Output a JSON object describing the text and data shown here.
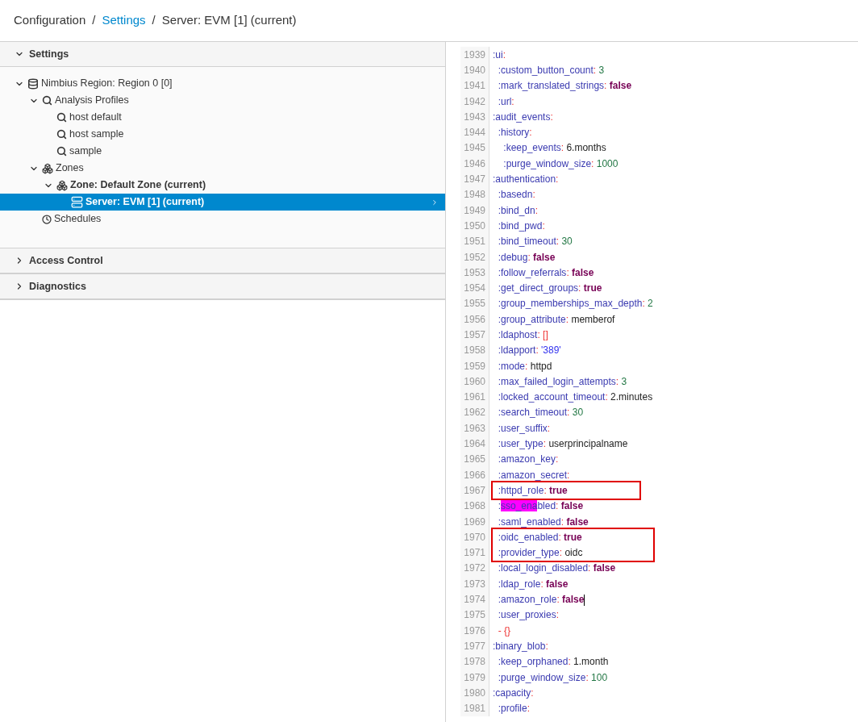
{
  "breadcrumb": [
    {
      "label": "Configuration",
      "link": false
    },
    {
      "separator": "/",
      "label": "Settings",
      "link": true
    },
    {
      "separator": "/",
      "label": "Server: EVM [1] (current)",
      "link": false
    }
  ],
  "sidebar": {
    "sections": [
      {
        "title": "Settings",
        "expanded": true,
        "tree": [
          {
            "label": "Nimbius Region: Region 0 [0]",
            "kind": "database",
            "bold": false,
            "selected": false,
            "expanded": true,
            "children": [
              {
                "label": "Analysis Profiles",
                "kind": "search",
                "bold": false,
                "selected": false,
                "expanded": true,
                "children": [
                  {
                    "label": "host default",
                    "kind": "search",
                    "bold": false,
                    "selected": false
                  },
                  {
                    "label": "host sample",
                    "kind": "search",
                    "bold": false,
                    "selected": false
                  },
                  {
                    "label": "sample",
                    "kind": "search",
                    "bold": false,
                    "selected": false
                  }
                ]
              },
              {
                "label": "Zones",
                "kind": "zone",
                "bold": false,
                "selected": false,
                "expanded": true,
                "children": [
                  {
                    "label": "Zone: Default Zone (current)",
                    "kind": "zone",
                    "bold": true,
                    "selected": false,
                    "expanded": true,
                    "children": [
                      {
                        "label": "Server: EVM [1] (current)",
                        "kind": "server",
                        "bold": true,
                        "selected": true
                      }
                    ]
                  }
                ]
              },
              {
                "label": "Schedules",
                "kind": "clock",
                "bold": false,
                "selected": false
              }
            ]
          }
        ]
      },
      {
        "title": "Access Control",
        "expanded": false
      },
      {
        "title": "Diagnostics",
        "expanded": false
      }
    ]
  },
  "editor": {
    "lines": [
      {
        "number": "1939",
        "tokens": [
          {
            "t": ":ui",
            "kind": "key"
          },
          {
            "t": ":",
            "kind": "punct"
          }
        ]
      },
      {
        "number": "1940",
        "tokens": [
          {
            "t": "  :custom_button_count",
            "kind": "key"
          },
          {
            "t": ":",
            "kind": "punct"
          },
          {
            "t": " 3",
            "kind": "number"
          }
        ]
      },
      {
        "number": "1941",
        "tokens": [
          {
            "t": "  :mark_translated_strings",
            "kind": "key"
          },
          {
            "t": ":",
            "kind": "punct"
          },
          {
            "t": " false",
            "kind": "bool"
          }
        ]
      },
      {
        "number": "1942",
        "tokens": [
          {
            "t": "  :url",
            "kind": "key"
          },
          {
            "t": ":",
            "kind": "punct"
          }
        ]
      },
      {
        "number": "1943",
        "tokens": [
          {
            "t": ":audit_events",
            "kind": "key"
          },
          {
            "t": ":",
            "kind": "punct"
          }
        ]
      },
      {
        "number": "1944",
        "tokens": [
          {
            "t": "  :history",
            "kind": "key"
          },
          {
            "t": ":",
            "kind": "punct"
          }
        ]
      },
      {
        "number": "1945",
        "tokens": [
          {
            "t": "    :keep_events",
            "kind": "key"
          },
          {
            "t": ":",
            "kind": "punct"
          },
          {
            "t": " 6.months",
            "kind": "plain"
          }
        ]
      },
      {
        "number": "1946",
        "tokens": [
          {
            "t": "    :purge_window_size",
            "kind": "key"
          },
          {
            "t": ":",
            "kind": "punct"
          },
          {
            "t": " 1000",
            "kind": "number"
          }
        ]
      },
      {
        "number": "1947",
        "tokens": [
          {
            "t": ":authentication",
            "kind": "key"
          },
          {
            "t": ":",
            "kind": "punct"
          }
        ]
      },
      {
        "number": "1948",
        "tokens": [
          {
            "t": "  :basedn",
            "kind": "key"
          },
          {
            "t": ":",
            "kind": "punct"
          }
        ]
      },
      {
        "number": "1949",
        "tokens": [
          {
            "t": "  :bind_dn",
            "kind": "key"
          },
          {
            "t": ":",
            "kind": "punct"
          }
        ]
      },
      {
        "number": "1950",
        "tokens": [
          {
            "t": "  :bind_pwd",
            "kind": "key"
          },
          {
            "t": ":",
            "kind": "punct"
          }
        ]
      },
      {
        "number": "1951",
        "tokens": [
          {
            "t": "  :bind_timeout",
            "kind": "key"
          },
          {
            "t": ":",
            "kind": "punct"
          },
          {
            "t": " 30",
            "kind": "number"
          }
        ]
      },
      {
        "number": "1952",
        "tokens": [
          {
            "t": "  :debug",
            "kind": "key"
          },
          {
            "t": ":",
            "kind": "punct"
          },
          {
            "t": " false",
            "kind": "bool"
          }
        ]
      },
      {
        "number": "1953",
        "tokens": [
          {
            "t": "  :follow_referrals",
            "kind": "key"
          },
          {
            "t": ":",
            "kind": "punct"
          },
          {
            "t": " false",
            "kind": "bool"
          }
        ]
      },
      {
        "number": "1954",
        "tokens": [
          {
            "t": "  :get_direct_groups",
            "kind": "key"
          },
          {
            "t": ":",
            "kind": "punct"
          },
          {
            "t": " true",
            "kind": "bool"
          }
        ]
      },
      {
        "number": "1955",
        "tokens": [
          {
            "t": "  :group_memberships_max_depth",
            "kind": "key"
          },
          {
            "t": ":",
            "kind": "punct"
          },
          {
            "t": " 2",
            "kind": "number"
          }
        ]
      },
      {
        "number": "1956",
        "tokens": [
          {
            "t": "  :group_attribute",
            "kind": "key"
          },
          {
            "t": ":",
            "kind": "punct"
          },
          {
            "t": " memberof",
            "kind": "plain"
          }
        ]
      },
      {
        "number": "1957",
        "tokens": [
          {
            "t": "  :ldaphost",
            "kind": "key"
          },
          {
            "t": ":",
            "kind": "punct"
          },
          {
            "t": " []",
            "kind": "punct"
          }
        ]
      },
      {
        "number": "1958",
        "tokens": [
          {
            "t": "  :ldapport",
            "kind": "key"
          },
          {
            "t": ":",
            "kind": "punct"
          },
          {
            "t": " '389'",
            "kind": "string"
          }
        ]
      },
      {
        "number": "1959",
        "tokens": [
          {
            "t": "  :mode",
            "kind": "key"
          },
          {
            "t": ":",
            "kind": "punct"
          },
          {
            "t": " httpd",
            "kind": "plain"
          }
        ]
      },
      {
        "number": "1960",
        "tokens": [
          {
            "t": "  :max_failed_login_attempts",
            "kind": "key"
          },
          {
            "t": ":",
            "kind": "punct"
          },
          {
            "t": " 3",
            "kind": "number"
          }
        ]
      },
      {
        "number": "1961",
        "tokens": [
          {
            "t": "  :locked_account_timeout",
            "kind": "key"
          },
          {
            "t": ":",
            "kind": "punct"
          },
          {
            "t": " 2.minutes",
            "kind": "plain"
          }
        ]
      },
      {
        "number": "1962",
        "tokens": [
          {
            "t": "  :search_timeout",
            "kind": "key"
          },
          {
            "t": ":",
            "kind": "punct"
          },
          {
            "t": " 30",
            "kind": "number"
          }
        ]
      },
      {
        "number": "1963",
        "tokens": [
          {
            "t": "  :user_suffix",
            "kind": "key"
          },
          {
            "t": ":",
            "kind": "punct"
          }
        ]
      },
      {
        "number": "1964",
        "tokens": [
          {
            "t": "  :user_type",
            "kind": "key"
          },
          {
            "t": ":",
            "kind": "punct"
          },
          {
            "t": " userprincipalname",
            "kind": "plain"
          }
        ]
      },
      {
        "number": "1965",
        "tokens": [
          {
            "t": "  :amazon_key",
            "kind": "key"
          },
          {
            "t": ":",
            "kind": "punct"
          }
        ]
      },
      {
        "number": "1966",
        "tokens": [
          {
            "t": "  :amazon_secret",
            "kind": "key"
          },
          {
            "t": ":",
            "kind": "punct"
          }
        ]
      },
      {
        "number": "1967",
        "boxed": true,
        "tokens": [
          {
            "t": "  :httpd_role",
            "kind": "key"
          },
          {
            "t": ":",
            "kind": "punct"
          },
          {
            "t": " true",
            "kind": "bool"
          }
        ]
      },
      {
        "number": "1968",
        "tokens": [
          {
            "t": "  :",
            "kind": "key"
          },
          {
            "t": "sso_ena",
            "kind": "match"
          },
          {
            "t": "bled",
            "kind": "key"
          },
          {
            "t": ":",
            "kind": "punct"
          },
          {
            "t": " false",
            "kind": "bool"
          }
        ]
      },
      {
        "number": "1969",
        "tokens": [
          {
            "t": "  :saml_enabled",
            "kind": "key"
          },
          {
            "t": ":",
            "kind": "punct"
          },
          {
            "t": " false",
            "kind": "bool"
          }
        ]
      },
      {
        "number": "1970",
        "boxed": true,
        "tokens": [
          {
            "t": "  :oidc_enabled",
            "kind": "key"
          },
          {
            "t": ":",
            "kind": "punct"
          },
          {
            "t": " true",
            "kind": "bool"
          }
        ]
      },
      {
        "number": "1971",
        "boxed": true,
        "tokens": [
          {
            "t": "  :provider_type",
            "kind": "key"
          },
          {
            "t": ":",
            "kind": "punct"
          },
          {
            "t": " oidc",
            "kind": "plain"
          }
        ]
      },
      {
        "number": "1972",
        "tokens": [
          {
            "t": "  :local_login_disabled",
            "kind": "key"
          },
          {
            "t": ":",
            "kind": "punct"
          },
          {
            "t": " false",
            "kind": "bool"
          }
        ]
      },
      {
        "number": "1973",
        "tokens": [
          {
            "t": "  :ldap_role",
            "kind": "key"
          },
          {
            "t": ":",
            "kind": "punct"
          },
          {
            "t": " false",
            "kind": "bool"
          }
        ]
      },
      {
        "number": "1974",
        "cursor": true,
        "tokens": [
          {
            "t": "  :amazon_role",
            "kind": "key"
          },
          {
            "t": ":",
            "kind": "punct"
          },
          {
            "t": " false",
            "kind": "bool"
          }
        ]
      },
      {
        "number": "1975",
        "tokens": [
          {
            "t": "  :user_proxies",
            "kind": "key"
          },
          {
            "t": ":",
            "kind": "punct"
          }
        ]
      },
      {
        "number": "1976",
        "tokens": [
          {
            "t": "  - {}",
            "kind": "punct"
          }
        ]
      },
      {
        "number": "1977",
        "tokens": [
          {
            "t": ":binary_blob",
            "kind": "key"
          },
          {
            "t": ":",
            "kind": "punct"
          }
        ]
      },
      {
        "number": "1978",
        "tokens": [
          {
            "t": "  :keep_orphaned",
            "kind": "key"
          },
          {
            "t": ":",
            "kind": "punct"
          },
          {
            "t": " 1.month",
            "kind": "plain"
          }
        ]
      },
      {
        "number": "1979",
        "tokens": [
          {
            "t": "  :purge_window_size",
            "kind": "key"
          },
          {
            "t": ":",
            "kind": "punct"
          },
          {
            "t": " 100",
            "kind": "number"
          }
        ]
      },
      {
        "number": "1980",
        "tokens": [
          {
            "t": ":capacity",
            "kind": "key"
          },
          {
            "t": ":",
            "kind": "punct"
          }
        ]
      },
      {
        "number": "1981",
        "tokens": [
          {
            "t": "  :profile",
            "kind": "key"
          },
          {
            "t": ":",
            "kind": "punct"
          }
        ]
      }
    ]
  }
}
